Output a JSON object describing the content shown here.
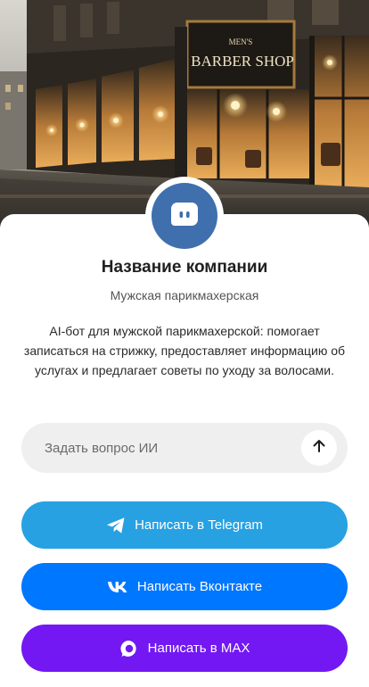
{
  "hero": {
    "image": "barber-shop-storefront",
    "sign_small": "MEN'S",
    "sign_main": "BARBER SHOP"
  },
  "profile": {
    "avatar_icon": "chat-bot-icon",
    "company_name": "Название компании",
    "subtitle": "Мужская парикмахерская",
    "description": "AI-бот для мужской парикмахерской: помогает записаться на стрижку, предоставляет информацию об услугах и предлагает советы по уходу за волосами."
  },
  "ask": {
    "placeholder": "Задать вопрос ИИ",
    "value": "",
    "send_icon": "arrow-up-icon"
  },
  "buttons": {
    "telegram": {
      "label": "Написать в Telegram",
      "icon": "telegram-icon",
      "color": "#27a1e2"
    },
    "vk": {
      "label": "Написать Вконтакте",
      "icon": "vk-icon",
      "color": "#0077ff"
    },
    "max": {
      "label": "Написать в MAX",
      "icon": "max-icon",
      "color": "#7318f2"
    }
  },
  "colors": {
    "avatar": "#3f6fad",
    "ask_background": "#efefef"
  }
}
